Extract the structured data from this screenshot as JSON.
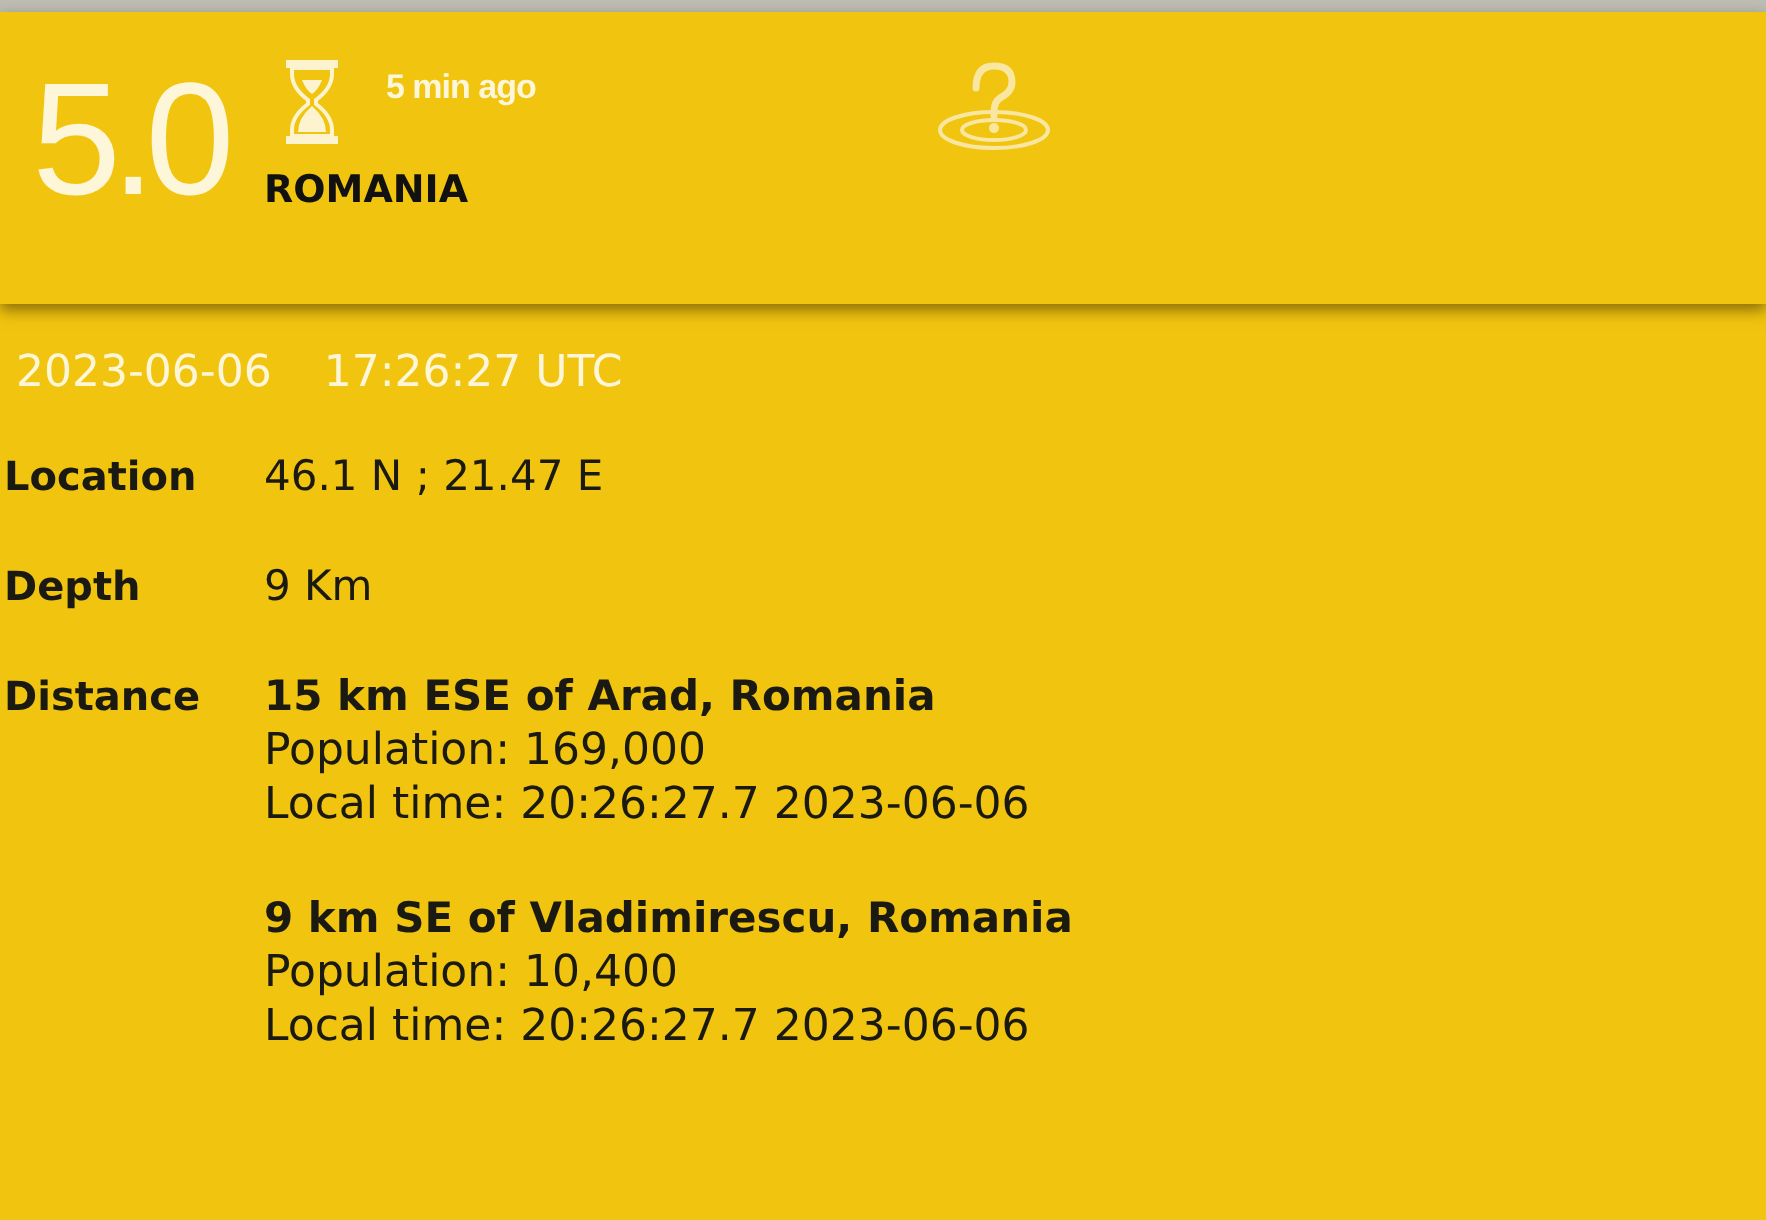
{
  "header": {
    "magnitude": "5.0",
    "time_ago": "5 min ago",
    "region": "ROMANIA"
  },
  "datetime": {
    "date": "2023-06-06",
    "time": "17:26:27 UTC"
  },
  "details": [
    {
      "label": "Location",
      "value": "46.1 N ; 21.47 E"
    },
    {
      "label": "Depth",
      "value": "9 Km"
    }
  ],
  "distance": {
    "label": "Distance",
    "places": [
      {
        "place": "15 km ESE of Arad, Romania",
        "population": "Population: 169,000",
        "local_time": "Local time: 20:26:27.7 2023-06-06"
      },
      {
        "place": "9 km SE of Vladimirescu, Romania",
        "population": "Population: 10,400",
        "local_time": "Local time: 20:26:27.7 2023-06-06"
      }
    ]
  }
}
